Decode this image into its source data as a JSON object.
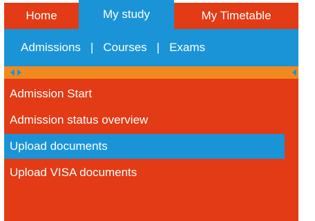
{
  "tabs": [
    {
      "label": "Home"
    },
    {
      "label": "My study"
    },
    {
      "label": "My Timetable"
    }
  ],
  "subnav": {
    "items": [
      "Admissions",
      "Courses",
      "Exams"
    ],
    "separator": "|"
  },
  "menu": {
    "items": [
      {
        "label": "Admission Start"
      },
      {
        "label": "Admission status overview"
      },
      {
        "label": "Upload documents",
        "active": true
      },
      {
        "label": "Upload VISA documents"
      }
    ]
  },
  "colors": {
    "tab_red": "#e23b15",
    "nav_blue": "#1a94d7",
    "strip_orange": "#f18a1e",
    "menu_red": "#e23b15"
  },
  "icons": {
    "scroll_left": "triangle-left-icon",
    "scroll_right": "triangle-right-icon"
  }
}
